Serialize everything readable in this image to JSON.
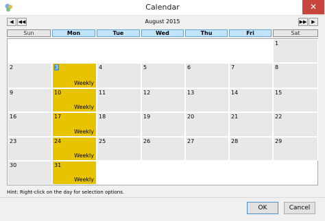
{
  "window": {
    "title": "Calendar",
    "close_glyph": "✕",
    "icon": "calendar-app-icon"
  },
  "navigation": {
    "month_label": "August 2015",
    "prev_month": "◀",
    "prev_year": "◀◀",
    "next_year": "▶▶",
    "next_month": "▶"
  },
  "weekdays": [
    {
      "label": "Sun",
      "kind": "weekend"
    },
    {
      "label": "Mon",
      "kind": "workday"
    },
    {
      "label": "Tue",
      "kind": "workday"
    },
    {
      "label": "Wed",
      "kind": "workday"
    },
    {
      "label": "Thu",
      "kind": "workday"
    },
    {
      "label": "Fri",
      "kind": "workday"
    },
    {
      "label": "Sat",
      "kind": "weekend"
    }
  ],
  "weeks": [
    [
      null,
      null,
      null,
      null,
      null,
      null,
      {
        "day": "1"
      }
    ],
    [
      {
        "day": "2"
      },
      {
        "day": "3",
        "today": true,
        "highlight": true,
        "event": "Weekly"
      },
      {
        "day": "4"
      },
      {
        "day": "5"
      },
      {
        "day": "6"
      },
      {
        "day": "7"
      },
      {
        "day": "8"
      }
    ],
    [
      {
        "day": "9"
      },
      {
        "day": "10",
        "highlight": true,
        "event": "Weekly"
      },
      {
        "day": "11"
      },
      {
        "day": "12"
      },
      {
        "day": "13"
      },
      {
        "day": "14"
      },
      {
        "day": "15"
      }
    ],
    [
      {
        "day": "16"
      },
      {
        "day": "17",
        "highlight": true,
        "event": "Weekly"
      },
      {
        "day": "18"
      },
      {
        "day": "19"
      },
      {
        "day": "20"
      },
      {
        "day": "21"
      },
      {
        "day": "22"
      }
    ],
    [
      {
        "day": "23"
      },
      {
        "day": "24",
        "highlight": true,
        "event": "Weekly"
      },
      {
        "day": "25"
      },
      {
        "day": "26"
      },
      {
        "day": "27"
      },
      {
        "day": "28"
      },
      {
        "day": "29"
      }
    ],
    [
      {
        "day": "30"
      },
      {
        "day": "31",
        "highlight": true,
        "event": "Weekly"
      },
      null,
      null,
      null,
      null,
      null
    ]
  ],
  "hint": "Hint: Right-click on the day for selection options.",
  "buttons": {
    "ok": "OK",
    "cancel": "Cancel"
  },
  "colors": {
    "highlight": "#e8c300",
    "workday_header": "#bfe3fb",
    "today": "#3b8fe3",
    "close": "#c7453d"
  }
}
